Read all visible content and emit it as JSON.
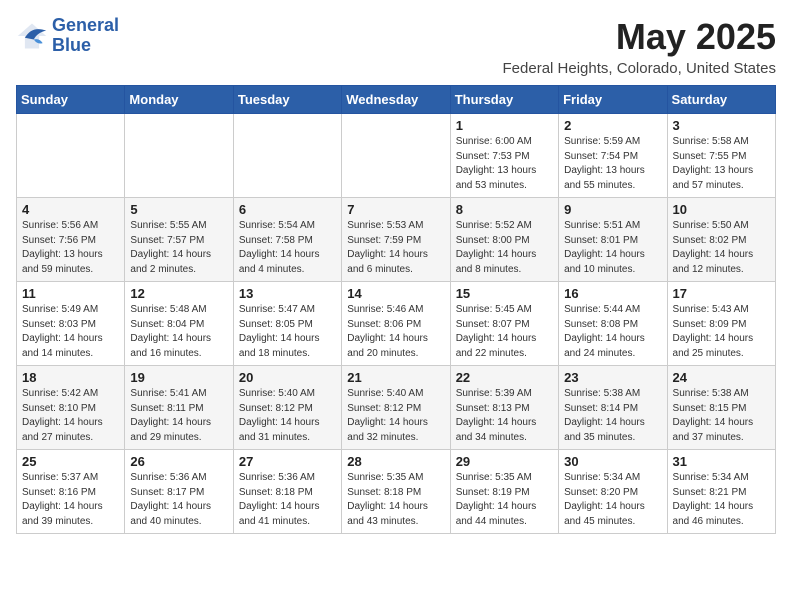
{
  "header": {
    "logo_line1": "General",
    "logo_line2": "Blue",
    "month": "May 2025",
    "location": "Federal Heights, Colorado, United States"
  },
  "weekdays": [
    "Sunday",
    "Monday",
    "Tuesday",
    "Wednesday",
    "Thursday",
    "Friday",
    "Saturday"
  ],
  "weeks": [
    [
      {
        "day": "",
        "info": ""
      },
      {
        "day": "",
        "info": ""
      },
      {
        "day": "",
        "info": ""
      },
      {
        "day": "",
        "info": ""
      },
      {
        "day": "1",
        "info": "Sunrise: 6:00 AM\nSunset: 7:53 PM\nDaylight: 13 hours\nand 53 minutes."
      },
      {
        "day": "2",
        "info": "Sunrise: 5:59 AM\nSunset: 7:54 PM\nDaylight: 13 hours\nand 55 minutes."
      },
      {
        "day": "3",
        "info": "Sunrise: 5:58 AM\nSunset: 7:55 PM\nDaylight: 13 hours\nand 57 minutes."
      }
    ],
    [
      {
        "day": "4",
        "info": "Sunrise: 5:56 AM\nSunset: 7:56 PM\nDaylight: 13 hours\nand 59 minutes."
      },
      {
        "day": "5",
        "info": "Sunrise: 5:55 AM\nSunset: 7:57 PM\nDaylight: 14 hours\nand 2 minutes."
      },
      {
        "day": "6",
        "info": "Sunrise: 5:54 AM\nSunset: 7:58 PM\nDaylight: 14 hours\nand 4 minutes."
      },
      {
        "day": "7",
        "info": "Sunrise: 5:53 AM\nSunset: 7:59 PM\nDaylight: 14 hours\nand 6 minutes."
      },
      {
        "day": "8",
        "info": "Sunrise: 5:52 AM\nSunset: 8:00 PM\nDaylight: 14 hours\nand 8 minutes."
      },
      {
        "day": "9",
        "info": "Sunrise: 5:51 AM\nSunset: 8:01 PM\nDaylight: 14 hours\nand 10 minutes."
      },
      {
        "day": "10",
        "info": "Sunrise: 5:50 AM\nSunset: 8:02 PM\nDaylight: 14 hours\nand 12 minutes."
      }
    ],
    [
      {
        "day": "11",
        "info": "Sunrise: 5:49 AM\nSunset: 8:03 PM\nDaylight: 14 hours\nand 14 minutes."
      },
      {
        "day": "12",
        "info": "Sunrise: 5:48 AM\nSunset: 8:04 PM\nDaylight: 14 hours\nand 16 minutes."
      },
      {
        "day": "13",
        "info": "Sunrise: 5:47 AM\nSunset: 8:05 PM\nDaylight: 14 hours\nand 18 minutes."
      },
      {
        "day": "14",
        "info": "Sunrise: 5:46 AM\nSunset: 8:06 PM\nDaylight: 14 hours\nand 20 minutes."
      },
      {
        "day": "15",
        "info": "Sunrise: 5:45 AM\nSunset: 8:07 PM\nDaylight: 14 hours\nand 22 minutes."
      },
      {
        "day": "16",
        "info": "Sunrise: 5:44 AM\nSunset: 8:08 PM\nDaylight: 14 hours\nand 24 minutes."
      },
      {
        "day": "17",
        "info": "Sunrise: 5:43 AM\nSunset: 8:09 PM\nDaylight: 14 hours\nand 25 minutes."
      }
    ],
    [
      {
        "day": "18",
        "info": "Sunrise: 5:42 AM\nSunset: 8:10 PM\nDaylight: 14 hours\nand 27 minutes."
      },
      {
        "day": "19",
        "info": "Sunrise: 5:41 AM\nSunset: 8:11 PM\nDaylight: 14 hours\nand 29 minutes."
      },
      {
        "day": "20",
        "info": "Sunrise: 5:40 AM\nSunset: 8:12 PM\nDaylight: 14 hours\nand 31 minutes."
      },
      {
        "day": "21",
        "info": "Sunrise: 5:40 AM\nSunset: 8:12 PM\nDaylight: 14 hours\nand 32 minutes."
      },
      {
        "day": "22",
        "info": "Sunrise: 5:39 AM\nSunset: 8:13 PM\nDaylight: 14 hours\nand 34 minutes."
      },
      {
        "day": "23",
        "info": "Sunrise: 5:38 AM\nSunset: 8:14 PM\nDaylight: 14 hours\nand 35 minutes."
      },
      {
        "day": "24",
        "info": "Sunrise: 5:38 AM\nSunset: 8:15 PM\nDaylight: 14 hours\nand 37 minutes."
      }
    ],
    [
      {
        "day": "25",
        "info": "Sunrise: 5:37 AM\nSunset: 8:16 PM\nDaylight: 14 hours\nand 39 minutes."
      },
      {
        "day": "26",
        "info": "Sunrise: 5:36 AM\nSunset: 8:17 PM\nDaylight: 14 hours\nand 40 minutes."
      },
      {
        "day": "27",
        "info": "Sunrise: 5:36 AM\nSunset: 8:18 PM\nDaylight: 14 hours\nand 41 minutes."
      },
      {
        "day": "28",
        "info": "Sunrise: 5:35 AM\nSunset: 8:18 PM\nDaylight: 14 hours\nand 43 minutes."
      },
      {
        "day": "29",
        "info": "Sunrise: 5:35 AM\nSunset: 8:19 PM\nDaylight: 14 hours\nand 44 minutes."
      },
      {
        "day": "30",
        "info": "Sunrise: 5:34 AM\nSunset: 8:20 PM\nDaylight: 14 hours\nand 45 minutes."
      },
      {
        "day": "31",
        "info": "Sunrise: 5:34 AM\nSunset: 8:21 PM\nDaylight: 14 hours\nand 46 minutes."
      }
    ]
  ]
}
